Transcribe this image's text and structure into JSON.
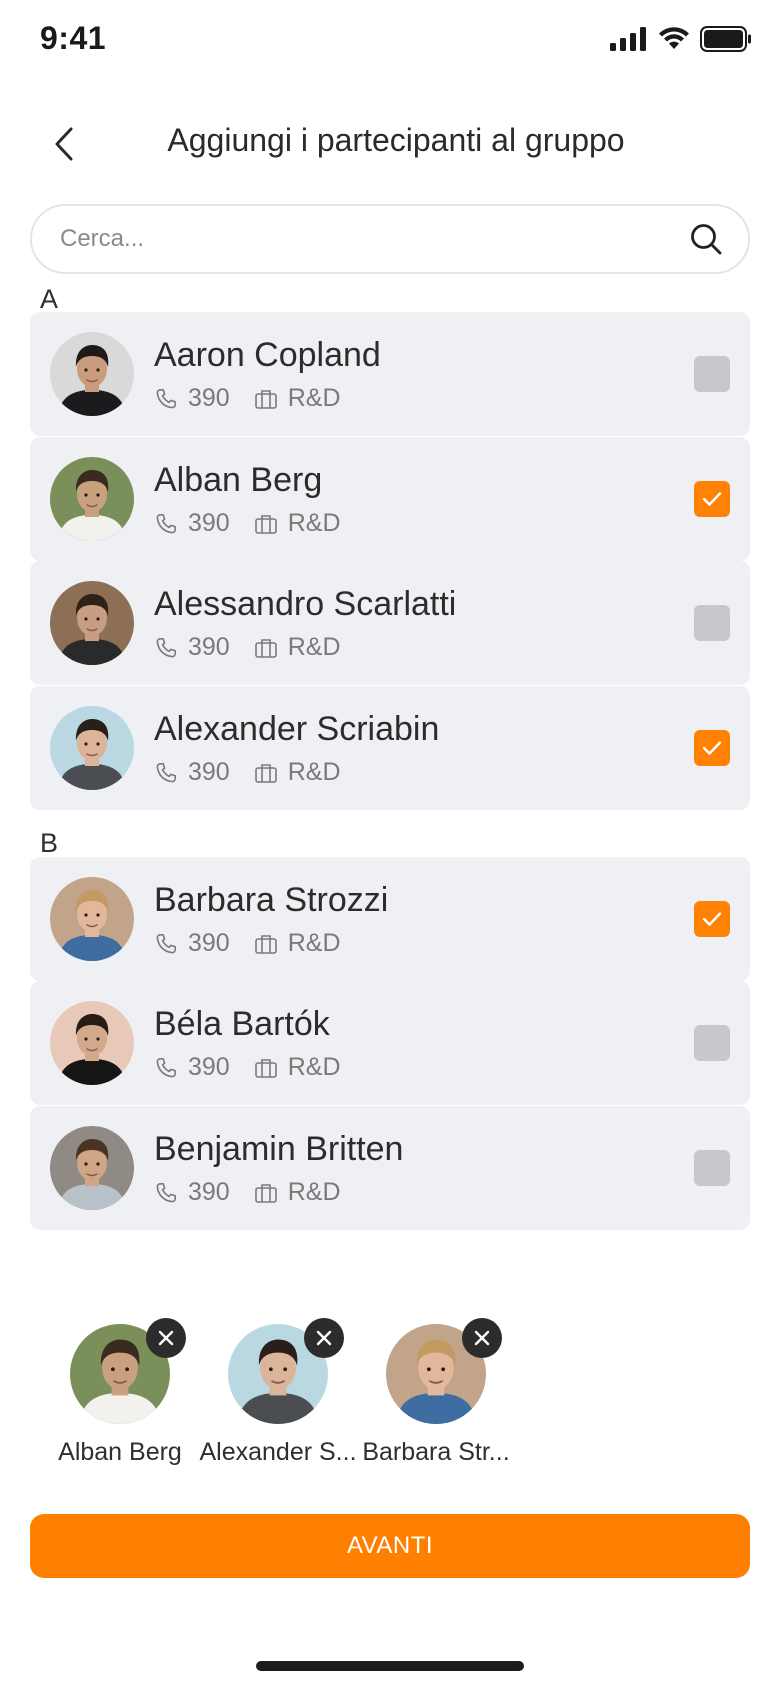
{
  "status_bar": {
    "time": "9:41"
  },
  "header": {
    "title": "Aggiungi i partecipanti al gruppo"
  },
  "search": {
    "placeholder": "Cerca..."
  },
  "sections": [
    {
      "letter": "A",
      "contacts": [
        {
          "name": "Aaron Copland",
          "phone": "390",
          "department": "R&D",
          "checked": false,
          "avatar_colors": [
            "#d9d9d9",
            "#1f1a17",
            "#c89c7d",
            "#1b1b1d"
          ]
        },
        {
          "name": "Alban Berg",
          "phone": "390",
          "department": "R&D",
          "checked": true,
          "avatar_colors": [
            "#7b8f5a",
            "#3a2a20",
            "#caa17f",
            "#f2f1ee"
          ]
        },
        {
          "name": "Alessandro Scarlatti",
          "phone": "390",
          "department": "R&D",
          "checked": false,
          "avatar_colors": [
            "#8c6f55",
            "#2f221a",
            "#c79e81",
            "#2a2a2a"
          ]
        },
        {
          "name": "Alexander Scriabin",
          "phone": "390",
          "department": "R&D",
          "checked": true,
          "avatar_colors": [
            "#b9d8e1",
            "#2a1f18",
            "#dcb49a",
            "#4a4d52"
          ]
        }
      ]
    },
    {
      "letter": "B",
      "contacts": [
        {
          "name": "Barbara Strozzi",
          "phone": "390",
          "department": "R&D",
          "checked": true,
          "avatar_colors": [
            "#c2a48a",
            "#c49a63",
            "#e1b89c",
            "#3f6da1"
          ]
        },
        {
          "name": "Béla Bartók",
          "phone": "390",
          "department": "R&D",
          "checked": false,
          "avatar_colors": [
            "#e8c8b8",
            "#2b1d15",
            "#d3a98c",
            "#151515"
          ]
        },
        {
          "name": "Benjamin Britten",
          "phone": "390",
          "department": "R&D",
          "checked": false,
          "avatar_colors": [
            "#8f8a84",
            "#4a3322",
            "#cfa487",
            "#b9c1c8"
          ]
        }
      ]
    }
  ],
  "selected": [
    {
      "name": "Alban Berg",
      "avatar_colors": [
        "#7b8f5a",
        "#3a2a20",
        "#caa17f",
        "#f2f1ee"
      ]
    },
    {
      "name": "Alexander S...",
      "avatar_colors": [
        "#b9d8e1",
        "#2a1f18",
        "#dcb49a",
        "#4a4d52"
      ]
    },
    {
      "name": "Barbara Str...",
      "avatar_colors": [
        "#c2a48a",
        "#c49a63",
        "#e1b89c",
        "#3f6da1"
      ]
    }
  ],
  "primary_button": {
    "label": "AVANTI"
  },
  "colors": {
    "accent": "#ff8205",
    "row_bg": "#eff0f3",
    "unchecked": "#c6c8cc"
  },
  "icons": [
    "back-icon",
    "search-icon",
    "phone-icon",
    "briefcase-icon",
    "check-icon",
    "close-icon",
    "signal-icon",
    "wifi-icon",
    "battery-icon"
  ]
}
